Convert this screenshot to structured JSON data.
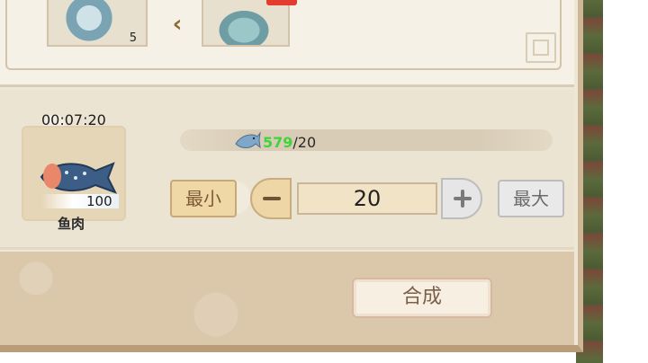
{
  "materials": {
    "slot1_count": "5",
    "slot2_art": "crab-icon"
  },
  "craft": {
    "timer": "00:07:20",
    "item_name": "鱼肉",
    "item_qty": "100",
    "requirement": {
      "have": "579",
      "need": "/20",
      "icon": "fish-icon"
    }
  },
  "controls": {
    "min_label": "最小",
    "max_label": "最大",
    "quantity": "20"
  },
  "action": {
    "synthesize_label": "合成"
  },
  "colors": {
    "have_green": "#3fd437",
    "panel_bg": "#efe7d6",
    "button_text": "#7b5a38"
  }
}
